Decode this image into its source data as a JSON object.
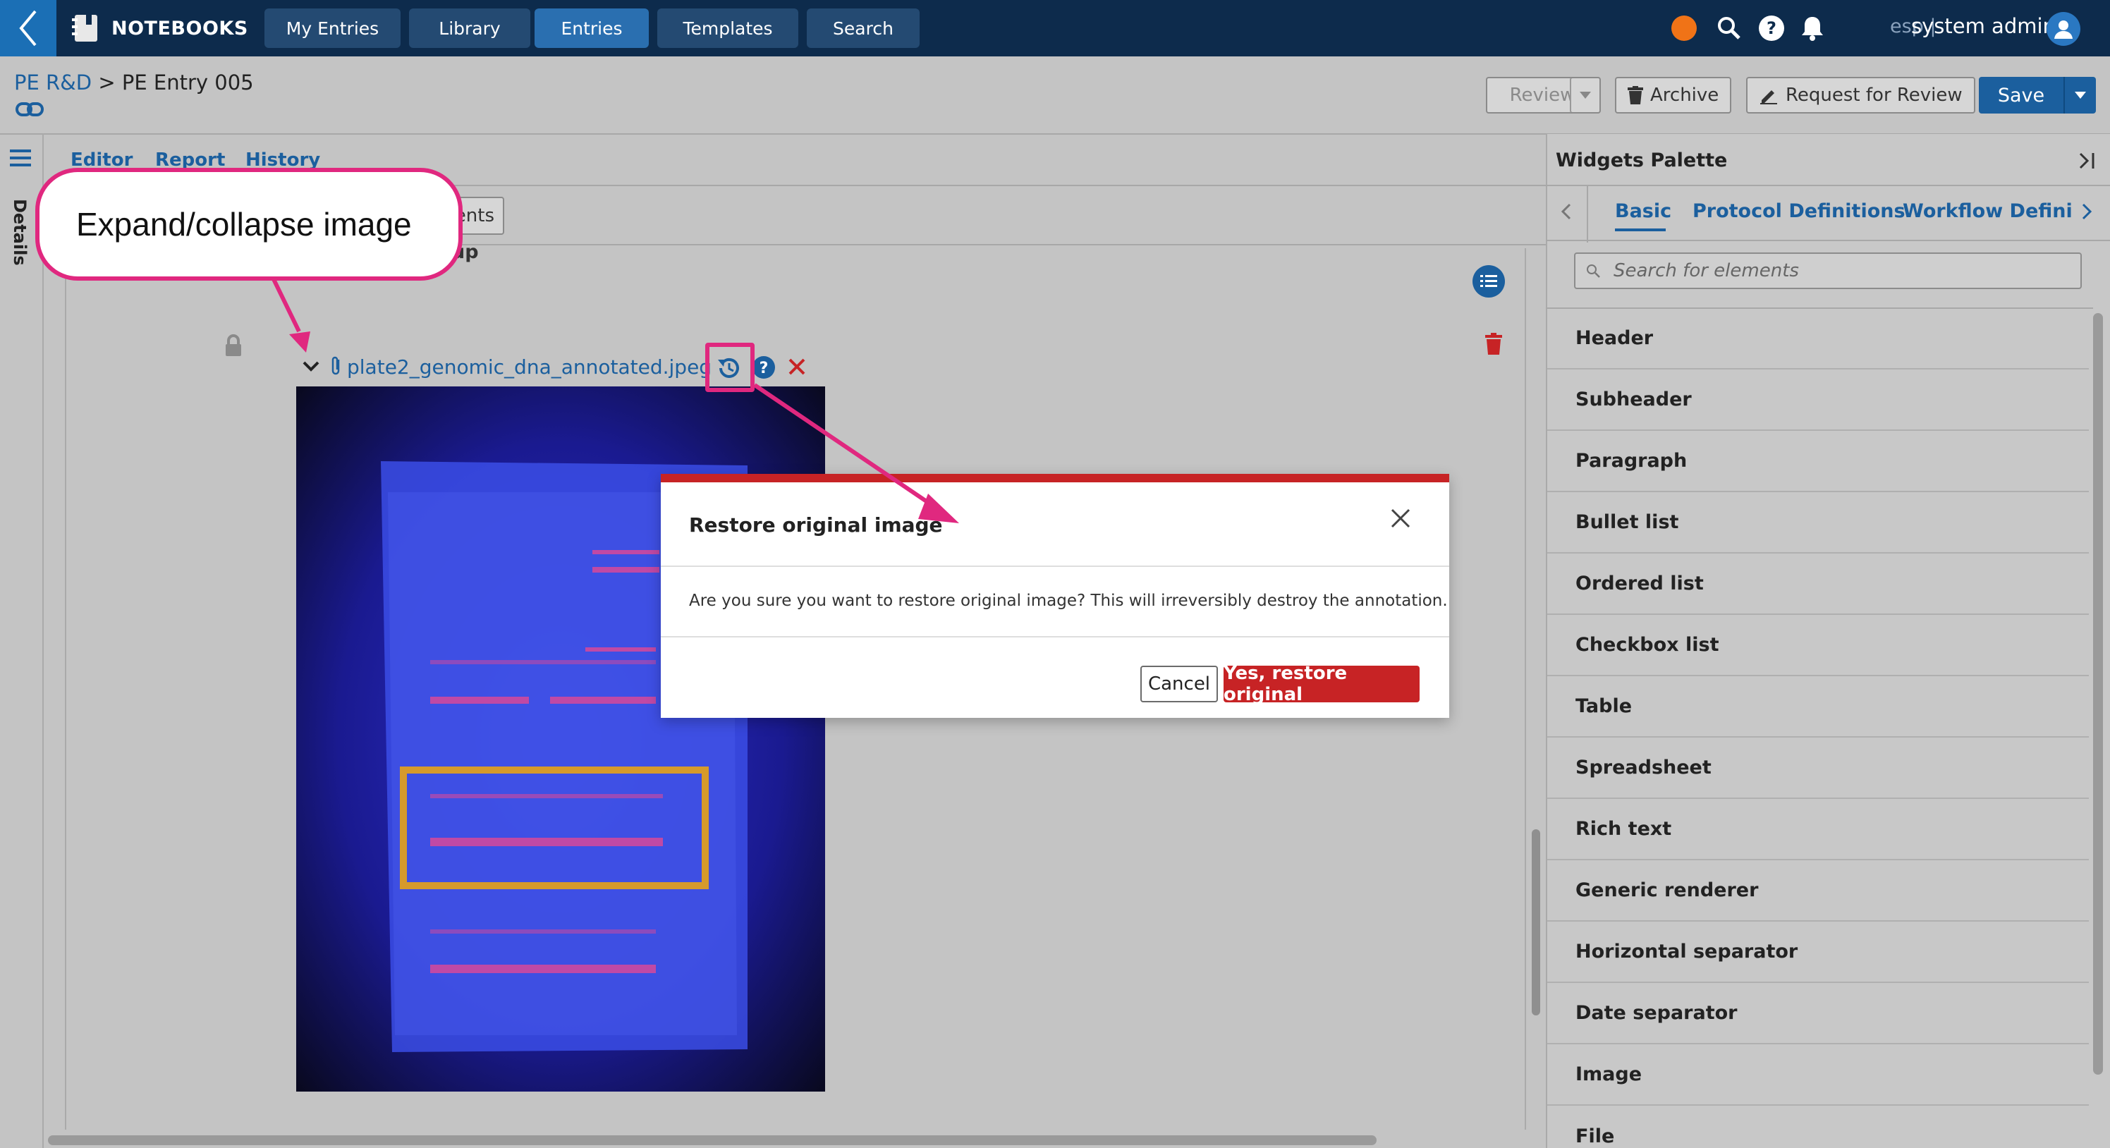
{
  "topbar": {
    "app_name": "NOTEBOOKS",
    "nav": [
      "My Entries",
      "Library",
      "Entries",
      "Templates",
      "Search"
    ],
    "active_nav": "Entries",
    "lang": "esp |",
    "user": "system admin",
    "accent": "#1b6fb5",
    "status_dot_color": "#f07317"
  },
  "breadcrumb": {
    "parent": "PE R&D",
    "separator": ">",
    "current": "PE Entry 005"
  },
  "actions": {
    "review": "Review",
    "archive": "Archive",
    "request_review": "Request for Review",
    "save": "Save"
  },
  "rail": {
    "label": "Details"
  },
  "editor": {
    "tabs": [
      "Editor",
      "Report",
      "History"
    ],
    "partial_button": "ents",
    "partial_text": "up",
    "file_name": "plate2_genomic_dna_annotated.jpeg"
  },
  "palette": {
    "title": "Widgets Palette",
    "tabs": [
      "Basic",
      "Protocol Definitions",
      "Workflow Definitio"
    ],
    "active_tab": "Basic",
    "search_placeholder": "Search for elements",
    "items": [
      "Header",
      "Subheader",
      "Paragraph",
      "Bullet list",
      "Ordered list",
      "Checkbox list",
      "Table",
      "Spreadsheet",
      "Rich text",
      "Generic renderer",
      "Horizontal separator",
      "Date separator",
      "Image",
      "File"
    ]
  },
  "callout": {
    "text": "Expand/collapse image",
    "color": "#e0287f"
  },
  "modal": {
    "title": "Restore original image",
    "message": "Are you sure you want to restore original image? This will irreversibly destroy the annotation.",
    "cancel": "Cancel",
    "confirm": "Yes, restore original",
    "accent": "#c72325"
  }
}
